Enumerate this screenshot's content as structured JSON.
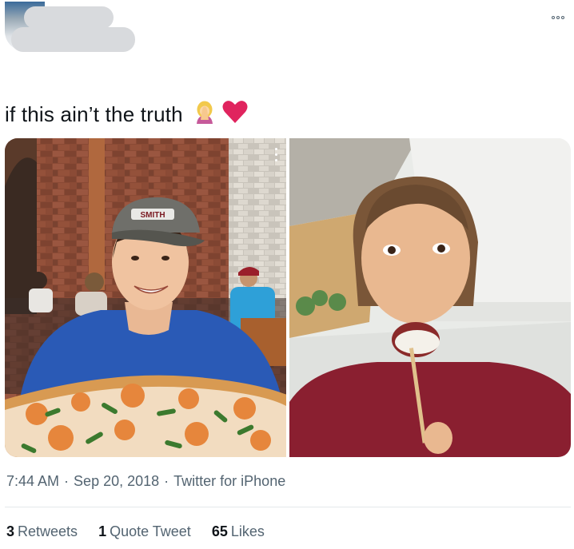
{
  "tweet": {
    "text": "if this ain’t the truth",
    "emojis": [
      "woman-facepalming-emoji",
      "red-heart-emoji"
    ],
    "time": "7:44 AM",
    "date": "Sep 20, 2018",
    "separator": "·",
    "source": "Twitter for iPhone"
  },
  "media": {
    "photos": [
      {
        "name": "photo-guy-with-pizza",
        "cap_text": "SMITH"
      },
      {
        "name": "photo-girl-eating-sushi"
      }
    ]
  },
  "stats": {
    "retweets_count": "3",
    "retweets_label": "Retweets",
    "quotes_count": "1",
    "quotes_label": "Quote Tweet",
    "likes_count": "65",
    "likes_label": "Likes"
  },
  "icons": {
    "more": "more-options-icon"
  },
  "colors": {
    "text_primary": "#0f1419",
    "text_secondary": "#536471",
    "heart": "#e0245e",
    "divider": "#e4e8eb"
  }
}
